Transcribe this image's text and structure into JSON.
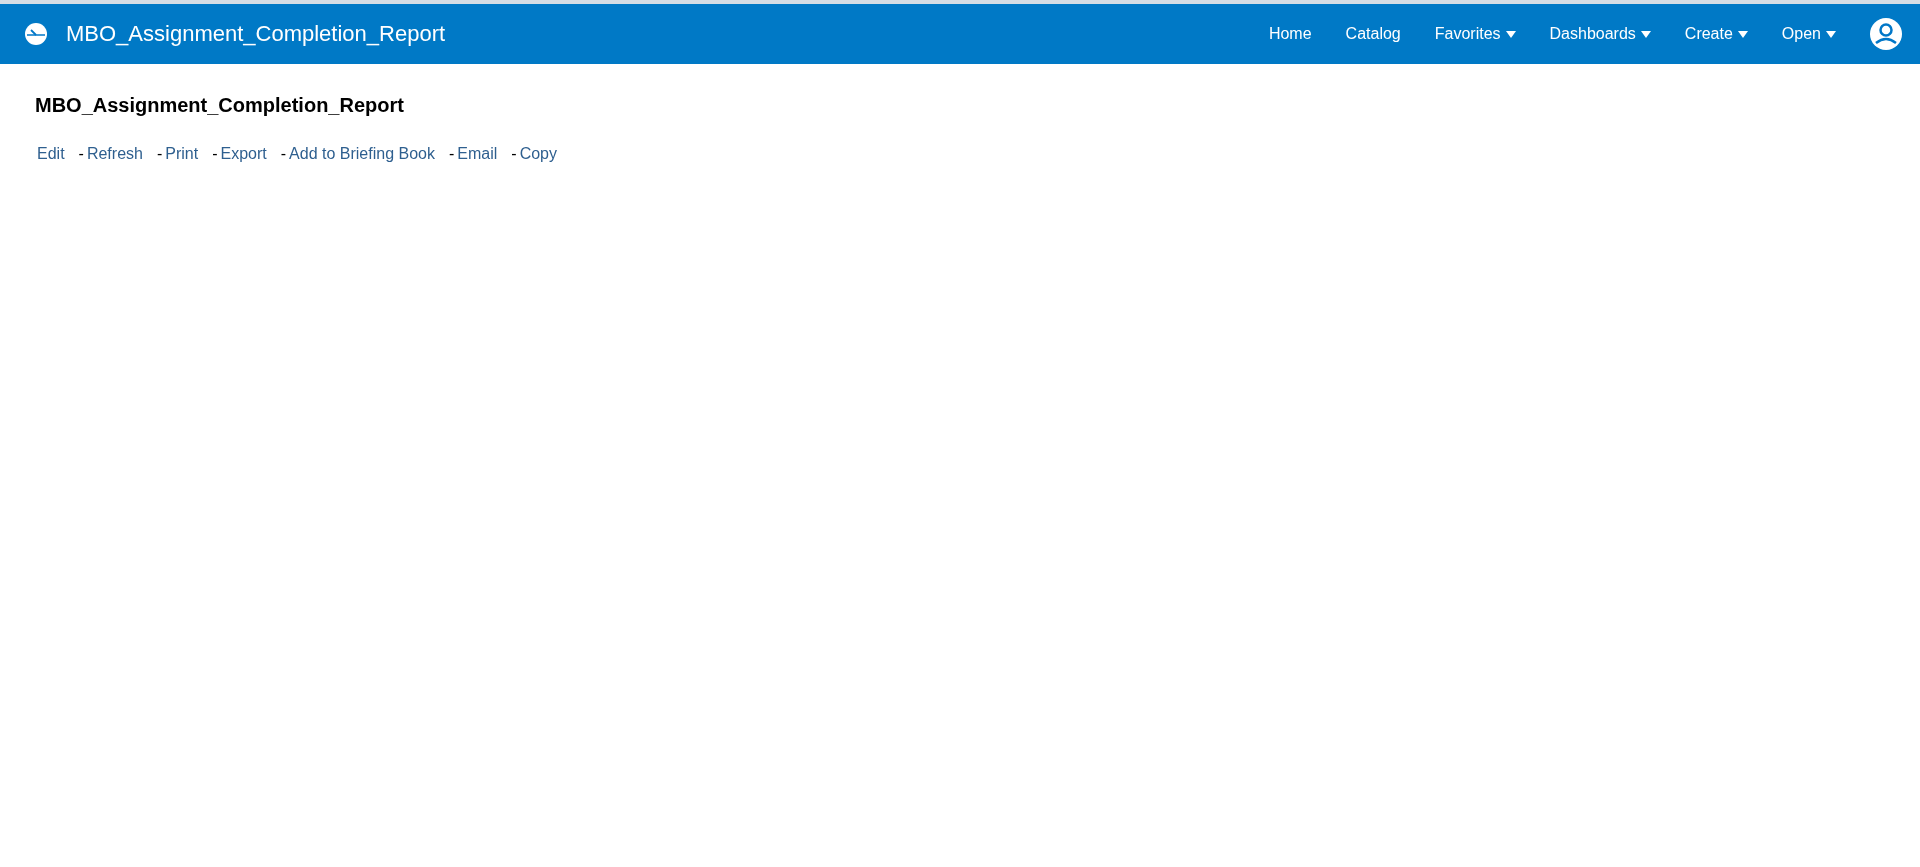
{
  "header": {
    "title": "MBO_Assignment_Completion_Report",
    "nav": [
      {
        "label": "Home",
        "dropdown": false
      },
      {
        "label": "Catalog",
        "dropdown": false
      },
      {
        "label": "Favorites",
        "dropdown": true
      },
      {
        "label": "Dashboards",
        "dropdown": true
      },
      {
        "label": "Create",
        "dropdown": true
      },
      {
        "label": "Open",
        "dropdown": true
      }
    ]
  },
  "page": {
    "title": "MBO_Assignment_Completion_Report",
    "actions": [
      {
        "label": "Edit"
      },
      {
        "separator": "-",
        "label": "Refresh"
      },
      {
        "separator": "-",
        "label": "Print"
      },
      {
        "separator": "-",
        "label": "Export"
      },
      {
        "separator": "-",
        "label": "Add to Briefing Book"
      },
      {
        "separator": "-",
        "label": "Email"
      },
      {
        "separator": "-",
        "label": "Copy"
      }
    ]
  }
}
